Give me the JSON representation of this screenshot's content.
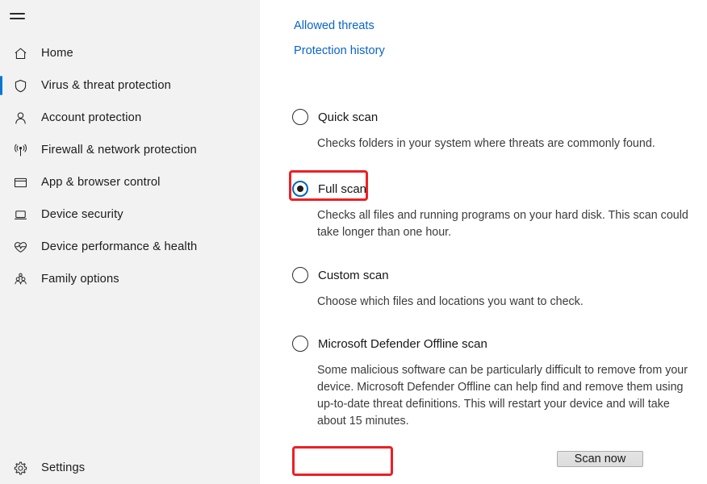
{
  "sidebar": {
    "menu_icon": "hamburger-icon",
    "items": [
      {
        "label": "Home",
        "icon": "home-icon",
        "selected": false
      },
      {
        "label": "Virus & threat protection",
        "icon": "shield-icon",
        "selected": true
      },
      {
        "label": "Account protection",
        "icon": "person-icon",
        "selected": false
      },
      {
        "label": "Firewall & network protection",
        "icon": "broadcast-icon",
        "selected": false
      },
      {
        "label": "App & browser control",
        "icon": "window-icon",
        "selected": false
      },
      {
        "label": "Device security",
        "icon": "laptop-icon",
        "selected": false
      },
      {
        "label": "Device performance & health",
        "icon": "heart-pulse-icon",
        "selected": false
      },
      {
        "label": "Family options",
        "icon": "people-icon",
        "selected": false
      }
    ],
    "settings": {
      "label": "Settings",
      "icon": "gear-icon"
    }
  },
  "main": {
    "links": [
      {
        "label": "Allowed threats",
        "name": "allowed-threats-link"
      },
      {
        "label": "Protection history",
        "name": "protection-history-link"
      }
    ],
    "scan_options": [
      {
        "label": "Quick scan",
        "description": "Checks folders in your system where threats are commonly found.",
        "checked": false
      },
      {
        "label": "Full scan",
        "description": "Checks all files and running programs on your hard disk. This scan could take longer than one hour.",
        "checked": true
      },
      {
        "label": "Custom scan",
        "description": "Choose which files and locations you want to check.",
        "checked": false
      },
      {
        "label": "Microsoft Defender Offline scan",
        "description": "Some malicious software can be particularly difficult to remove from your device. Microsoft Defender Offline can help find and remove them using up-to-date threat definitions. This will restart your device and will take about 15 minutes.",
        "checked": false
      }
    ],
    "scan_now_button": "Scan now"
  },
  "colors": {
    "accent_blue": "#0078d4",
    "link_blue": "#0a63c9",
    "annotation_red": "#ed2024",
    "sidebar_bg": "#f2f2f2"
  }
}
